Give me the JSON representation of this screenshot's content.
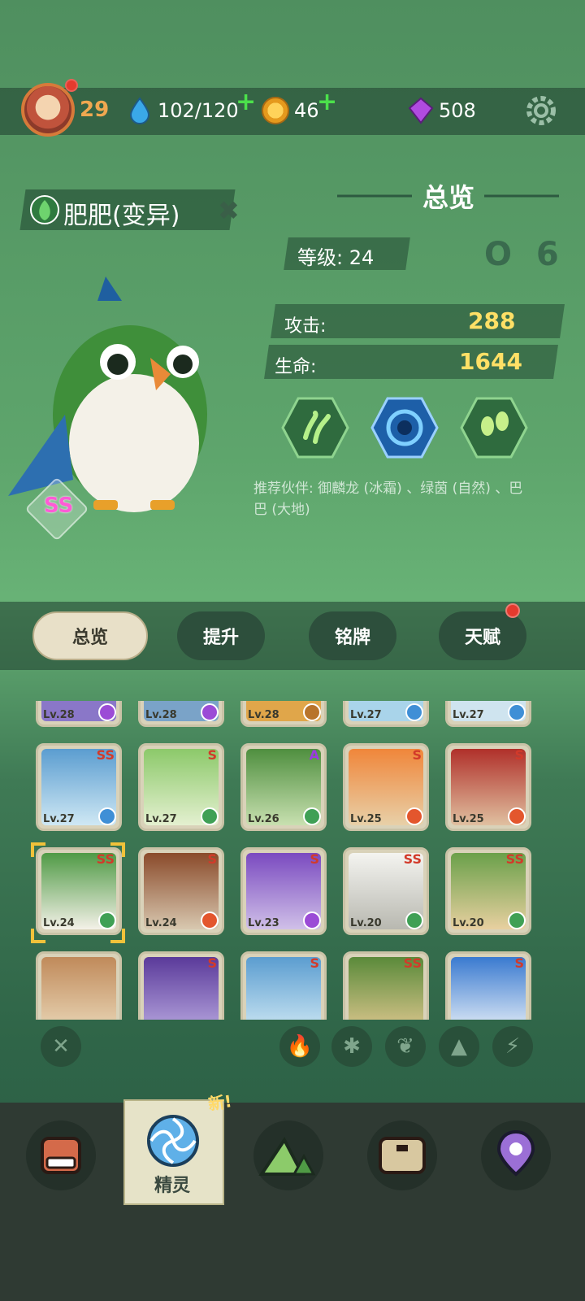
{
  "header": {
    "player_level": "29",
    "energy": "102/120",
    "coins": "46",
    "gems": "508",
    "plus_symbol": "+"
  },
  "pet": {
    "name": "肥肥(变异)",
    "grade": "SS",
    "close_symbol": "✖"
  },
  "overview": {
    "title": "总览",
    "level_label": "等级:",
    "level_value": "24",
    "attack_label": "攻击:",
    "attack_value": "288",
    "hp_label": "生命:",
    "hp_value": "1644",
    "badge_text": "O 6",
    "skills": [
      "grass-skill-icon",
      "whirlpool-skill-icon",
      "seed-skill-icon"
    ],
    "partner_text": "推荐伙伴: 御麟龙 (冰霜) 、绿茵 (自然) 、巴巴 (大地)"
  },
  "tabs": [
    {
      "label": "总览",
      "active": true
    },
    {
      "label": "提升",
      "active": false
    },
    {
      "label": "铭牌",
      "active": false
    },
    {
      "label": "天赋",
      "active": false
    }
  ],
  "grid": {
    "row0": [
      {
        "lv": "Lv.28",
        "element": "lightning"
      },
      {
        "lv": "Lv.28",
        "element": "lightning"
      },
      {
        "lv": "Lv.28",
        "element": "earth"
      },
      {
        "lv": "Lv.27",
        "element": "ice"
      },
      {
        "lv": "Lv.27",
        "element": "ice"
      }
    ],
    "row1": [
      {
        "lv": "Lv.27",
        "rank": "SS",
        "element": "ice"
      },
      {
        "lv": "Lv.27",
        "rank": "S",
        "element": "nature"
      },
      {
        "lv": "Lv.26",
        "rank": "A",
        "element": "nature"
      },
      {
        "lv": "Lv.25",
        "rank": "S",
        "element": "fire"
      },
      {
        "lv": "Lv.25",
        "rank": "S",
        "element": "fire"
      }
    ],
    "row2": [
      {
        "lv": "Lv.24",
        "rank": "SS",
        "element": "nature"
      },
      {
        "lv": "Lv.24",
        "rank": "S",
        "element": "fire"
      },
      {
        "lv": "Lv.23",
        "rank": "S",
        "element": "lightning"
      },
      {
        "lv": "Lv.20",
        "rank": "SS",
        "element": "nature"
      },
      {
        "lv": "Lv.20",
        "rank": "SS",
        "element": "nature"
      }
    ],
    "row3": [
      {
        "rank": "S"
      },
      {
        "rank": "S"
      },
      {
        "rank": "S"
      },
      {
        "rank": "SS"
      },
      {
        "rank": "S"
      }
    ]
  },
  "filters": [
    "clear",
    "fire",
    "ice",
    "nature",
    "earth",
    "lightning"
  ],
  "nav": {
    "active_label": "精灵",
    "new_badge": "新!"
  },
  "colors": {
    "fire": "#e3562d",
    "ice": "#3f8fd6",
    "nature": "#3fa055",
    "earth": "#b8742b",
    "lightning": "#9b4bd6",
    "accent_gold": "#ffe066"
  }
}
